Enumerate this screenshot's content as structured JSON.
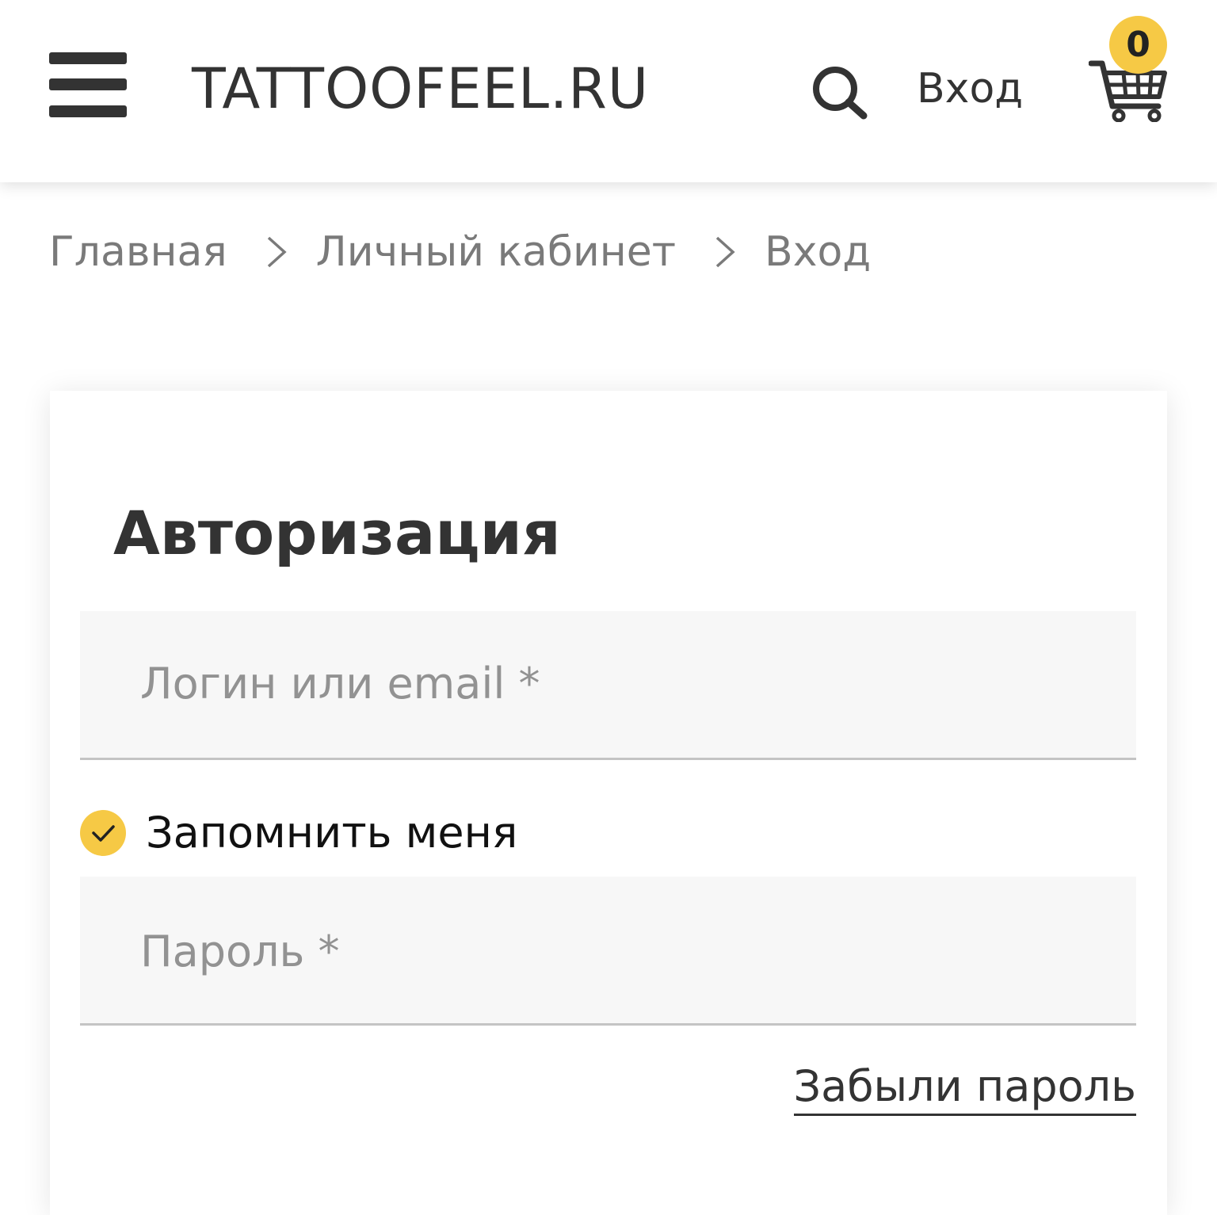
{
  "header": {
    "logo": "TATTOOFEEL.RU",
    "login_label": "Вход",
    "cart_count": "0"
  },
  "breadcrumb": {
    "items": [
      "Главная",
      "Личный кабинет",
      "Вход"
    ]
  },
  "auth": {
    "title": "Авторизация",
    "login_placeholder": "Логин или email *",
    "remember_label": "Запомнить меня",
    "remember_checked": true,
    "password_placeholder": "Пароль *",
    "forgot_label": "Забыли пароль"
  },
  "colors": {
    "accent": "#f6c945",
    "text": "#333333",
    "muted": "#7a7a7a",
    "field_bg": "#f7f7f7"
  }
}
